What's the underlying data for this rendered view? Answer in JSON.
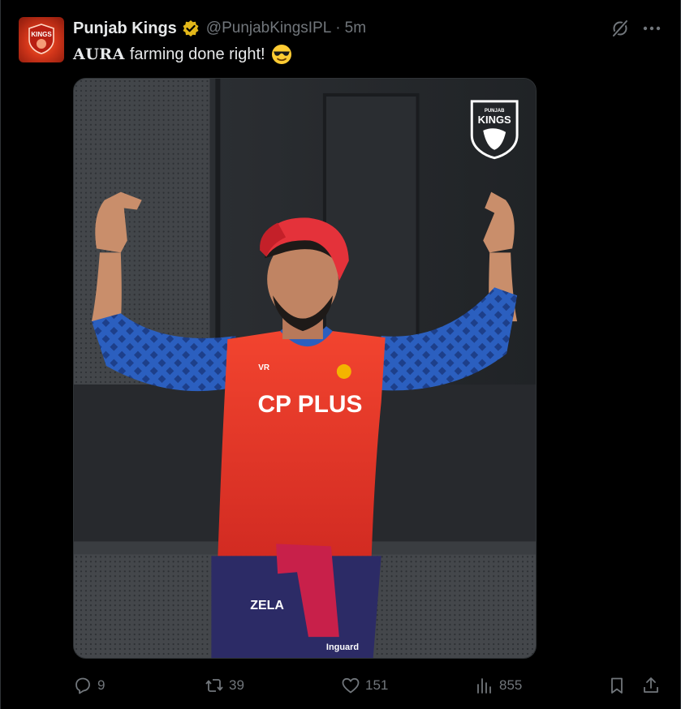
{
  "tweet": {
    "author_name": "Punjab Kings",
    "handle": "@PunjabKingsIPL",
    "separator": "·",
    "time": "5m",
    "text_aura": "AURA",
    "text_rest": "farming done right!",
    "emoji": "smiling-face-with-sunglasses",
    "avatar_label": "KINGS"
  },
  "media": {
    "logo_top": "PUNJAB",
    "logo_main": "KINGS",
    "jersey_sponsor": "CP PLUS",
    "jersey_small": "VR",
    "shorts_brand": "ZELA",
    "shorts_brand2": "Inguard"
  },
  "actions": {
    "replies": "9",
    "reposts": "39",
    "likes": "151",
    "views": "855"
  },
  "colors": {
    "background": "#000000",
    "text_primary": "#e7e9ea",
    "text_secondary": "#71767b",
    "verified_gold": "#e2b719",
    "jersey_red": "#e8372a",
    "sleeve_blue": "#2b5fbf"
  }
}
